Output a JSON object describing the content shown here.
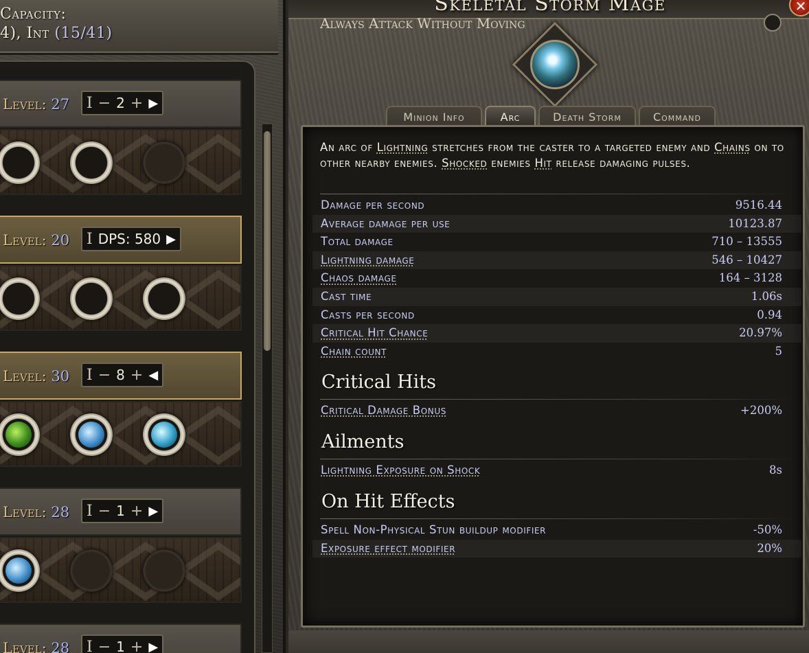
{
  "left_panel": {
    "capacity_label": "Capacity:",
    "capacity_prefix": "4), ",
    "stat_name": "Int",
    "stat_value": "(15/41)",
    "slots": [
      {
        "level_label": "Level:",
        "level": "27",
        "control": "stepper",
        "value": "2",
        "arrow": "▶",
        "active": false,
        "sockets": [
          "empty-ring",
          "empty-ring",
          "empty"
        ]
      },
      {
        "level_label": "Level:",
        "level": "20",
        "control": "dps",
        "dps_text": "DPS: 580",
        "arrow": "▶",
        "active": true,
        "sockets": [
          "empty-ring",
          "empty-ring",
          "empty-ring"
        ]
      },
      {
        "level_label": "Level:",
        "level": "30",
        "control": "stepper",
        "value": "8",
        "arrow": "◀",
        "active": true,
        "sockets": [
          "green-gem",
          "blue-gem",
          "cyan-gem"
        ]
      },
      {
        "level_label": "Level:",
        "level": "28",
        "control": "stepper",
        "value": "1",
        "arrow": "▶",
        "active": false,
        "sockets": [
          "blue-gem",
          "empty",
          "empty"
        ]
      },
      {
        "level_label": "Level:",
        "level": "28",
        "control": "stepper",
        "value": "1",
        "arrow": "▶",
        "active": false,
        "sockets": []
      }
    ]
  },
  "right_panel": {
    "title": "Skeletal Storm Mage",
    "close_label": "✕",
    "tabs": [
      "Minion Info",
      "Arc",
      "Death Storm",
      "Command"
    ],
    "active_tab": "Arc",
    "description": [
      {
        "t": "An arc of "
      },
      {
        "t": "Lightning",
        "k": true
      },
      {
        "t": " stretches from the caster to a targeted enemy and "
      },
      {
        "t": "Chains",
        "k": true
      },
      {
        "t": " on to other nearby enemies. "
      },
      {
        "t": "Shocked",
        "k": true
      },
      {
        "t": " enemies "
      },
      {
        "t": "Hit",
        "k": true
      },
      {
        "t": " release damaging pulses."
      }
    ],
    "stats": [
      {
        "label": "Damage per second",
        "value": "9516.44",
        "kw": false
      },
      {
        "label": "Average damage per use",
        "value": "10123.87",
        "kw": false
      },
      {
        "label": "Total damage",
        "value": "710 – 13555",
        "kw": false
      },
      {
        "label": "Lightning damage",
        "value": "546 – 10427",
        "kw": true
      },
      {
        "label": "Chaos damage",
        "value": "164 – 3128",
        "kw": true
      },
      {
        "label": "Cast time",
        "value": "1.06s",
        "kw": false
      },
      {
        "label": "Casts per second",
        "value": "0.94",
        "kw": false
      },
      {
        "label": "Critical Hit Chance",
        "value": "20.97%",
        "kw": true
      },
      {
        "label": "Chain count",
        "value": "5",
        "kw": true
      }
    ],
    "sections": [
      {
        "title": "Critical Hits",
        "rows": [
          {
            "label": "Critical Damage Bonus",
            "value": "+200%",
            "kw": true
          }
        ]
      },
      {
        "title": "Ailments",
        "rows": [
          {
            "label": "Lightning Exposure on Shock",
            "value": "8s",
            "kw": true
          }
        ]
      },
      {
        "title": "On Hit Effects",
        "rows": [
          {
            "label": "Spell Non-Physical Stun buildup modifier",
            "value": "-50%",
            "kw": false
          },
          {
            "label": "Exposure effect modifier",
            "value": "20%",
            "kw": true
          }
        ]
      }
    ],
    "bottom_label": "Always Attack Without Moving"
  },
  "colors": {
    "stat_text": "#c9cdf2",
    "level_text": "#d9bf86",
    "level_number": "#a9b4ec",
    "active_border": "#c9a866"
  },
  "icons": {
    "close": "close-icon",
    "arrow_right": "arrow-right-icon",
    "arrow_left": "arrow-left-icon",
    "minus": "minus-icon",
    "plus": "plus-icon"
  }
}
